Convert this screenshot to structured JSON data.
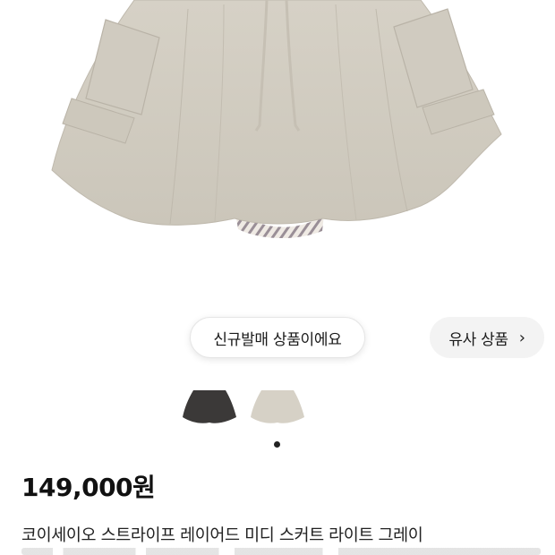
{
  "product": {
    "image_alt": "skirt-photo",
    "recommend_new_label": "신규발매 상품이에요",
    "similar_label": "유사 상품",
    "similar_chevron": "›",
    "colors": [
      {
        "name": "charcoal",
        "hex": "#3b3938"
      },
      {
        "name": "light-gray",
        "hex": "#d6d1c6"
      }
    ],
    "carousel_dots": 1,
    "price": "149,000원",
    "title": "코이세이오 스트라이프 레이어드 미디 스커트 라이트 그레이"
  },
  "colors": {
    "skirt": "#d2cdc2",
    "skirt_shadow": "#b9b3a7",
    "dot": "#222222"
  }
}
